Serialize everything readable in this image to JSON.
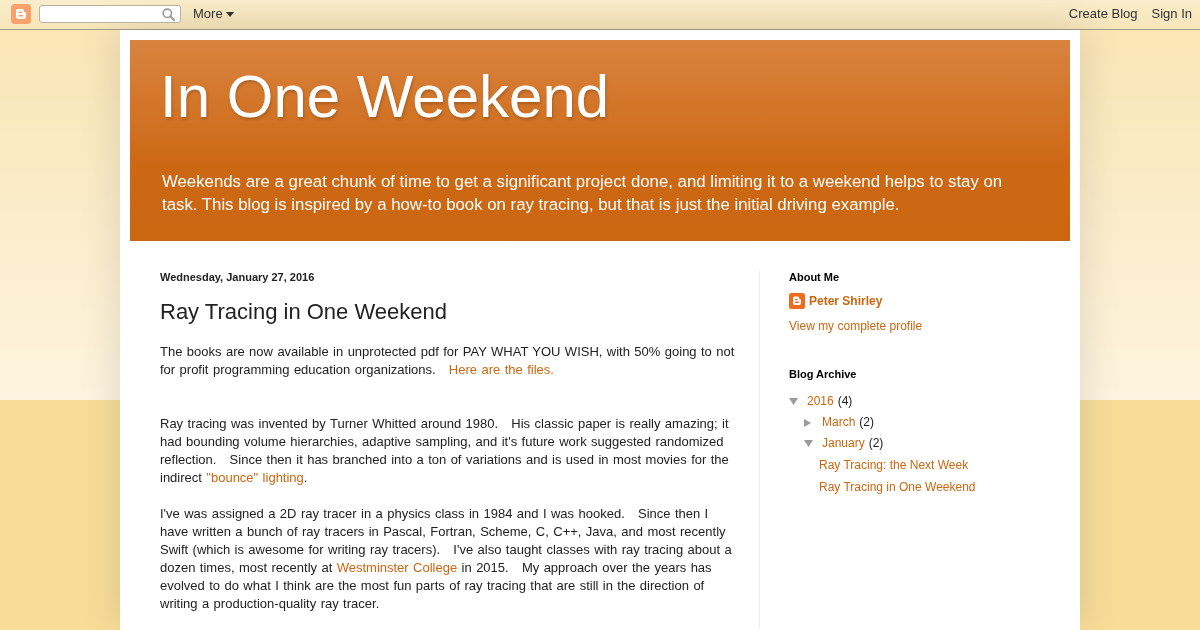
{
  "navbar": {
    "more_label": "More",
    "links": [
      "Create Blog",
      "Sign In"
    ]
  },
  "header": {
    "title": "In One Weekend",
    "description": "Weekends are a great chunk of time to get a significant project done, and limiting it to a weekend helps to stay on task. This blog is inspired by a how-to book on ray tracing, but that is just the initial driving example."
  },
  "post": {
    "date": "Wednesday, January 27, 2016",
    "title": "Ray Tracing in One Weekend",
    "paragraphs": [
      [
        {
          "text": "The books are now available in unprotected pdf for PAY WHAT YOU WISH, with 50% going to not for profit programming education organizations.   "
        },
        {
          "link": "Here are the files."
        }
      ],
      [
        {
          "text": "Ray tracing was invented by Turner Whitted around 1980.   His classic paper is really amazing; it had bounding volume hierarchies, adaptive sampling, and it's future work suggested randomized reflection.   Since then it has branched into a ton of variations and is used in most movies for the indirect "
        },
        {
          "link": "\"bounce\" lighting"
        },
        {
          "text": "."
        }
      ],
      [
        {
          "text": "I've was assigned a 2D ray tracer in a physics class in 1984 and I was hooked.   Since then I have written a bunch of ray tracers in Pascal, Fortran, Scheme, C, C++, Java, and most recently Swift (which is awesome for writing ray tracers).   I've also taught classes with ray tracing about a dozen times, most recently at "
        },
        {
          "link": "Westminster College"
        },
        {
          "text": " in 2015.   My approach over the years has evolved to do what I think are the most fun parts of ray tracing that are still in the direction of writing a production-quality ray tracer."
        }
      ]
    ]
  },
  "sidebar": {
    "about": {
      "heading": "About Me",
      "name": "Peter Shirley",
      "profile_link": "View my complete profile"
    },
    "archive": {
      "heading": "Blog Archive",
      "items": [
        {
          "label": "2016",
          "count": "(4)",
          "expanded": true,
          "children": [
            {
              "label": "March",
              "count": "(2)",
              "expanded": false
            },
            {
              "label": "January",
              "count": "(2)",
              "expanded": true,
              "children": [
                {
                  "label": "Ray Tracing: the Next Week"
                },
                {
                  "label": "Ray Tracing in One Weekend"
                }
              ]
            }
          ]
        }
      ]
    }
  }
}
